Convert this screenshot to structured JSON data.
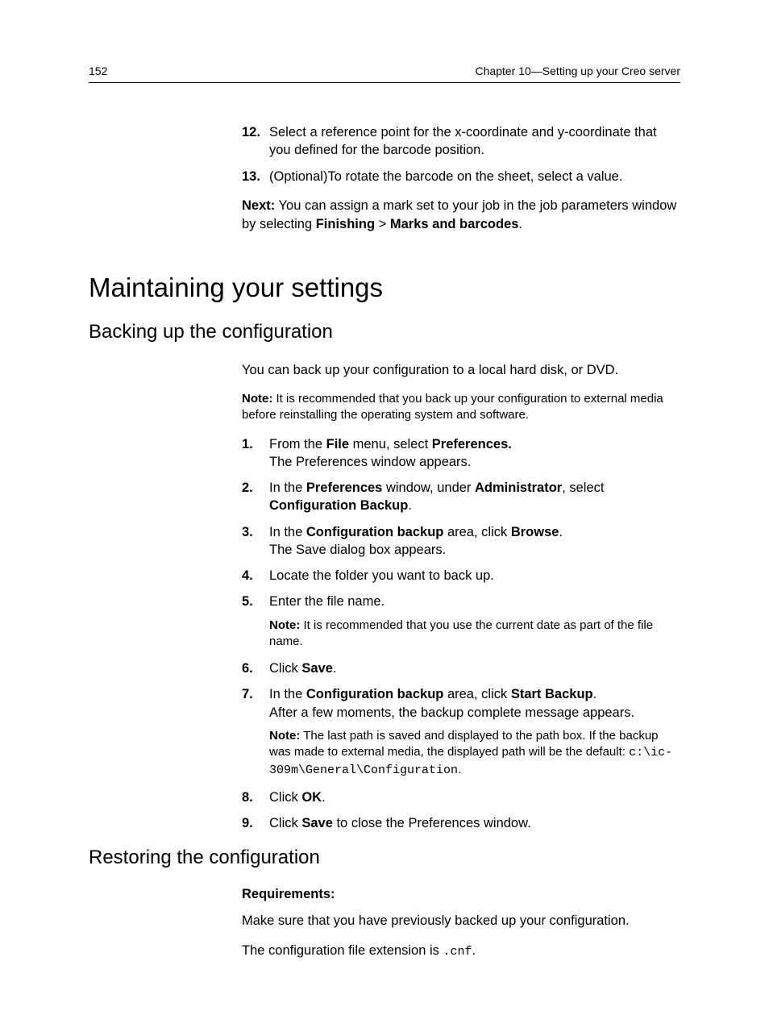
{
  "header": {
    "page_number": "152",
    "chapter": "Chapter 10—Setting up your Creo server"
  },
  "top_steps": {
    "s12": {
      "num": "12.",
      "text": "Select a reference point for the x-coordinate and y-coordinate that you defined for the barcode position."
    },
    "s13": {
      "num": "13.",
      "text": "(Optional)To rotate the barcode on the sheet, select a value."
    }
  },
  "next_block": {
    "label": "Next:",
    "pre": " You can assign a mark set to your job in the job parameters window by selecting ",
    "b1": "Finishing",
    "mid": " > ",
    "b2": "Marks and barcodes",
    "post": "."
  },
  "h1": "Maintaining your settings",
  "h2_backup": "Backing up the configuration",
  "backup_intro": "You can back up your configuration to a local hard disk, or DVD.",
  "backup_note_label": "Note:",
  "backup_note_text": " It is recommended that you back up your configuration to external media before reinstalling the operating system and software.",
  "backup_steps": {
    "s1": {
      "num": "1.",
      "pre": "From the ",
      "b1": "File",
      "mid": " menu, select ",
      "b2": "Preferences.",
      "line2": "The Preferences window appears."
    },
    "s2": {
      "num": "2.",
      "pre": "In the ",
      "b1": "Preferences",
      "mid": " window, under ",
      "b2": "Administrator",
      "post": ", select ",
      "b3": "Configuration Backup",
      "end": "."
    },
    "s3": {
      "num": "3.",
      "pre": "In the ",
      "b1": "Configuration backup",
      "mid": " area, click ",
      "b2": "Browse",
      "post": ".",
      "line2": "The Save dialog box appears."
    },
    "s4": {
      "num": "4.",
      "text": "Locate the folder you want to back up."
    },
    "s5": {
      "num": "5.",
      "text": "Enter the file name.",
      "note_label": "Note:",
      "note_text": " It is recommended that you use the current date as part of the file name."
    },
    "s6": {
      "num": "6.",
      "pre": "Click ",
      "b1": "Save",
      "post": "."
    },
    "s7": {
      "num": "7.",
      "pre": "In the ",
      "b1": "Configuration backup",
      "mid": " area, click ",
      "b2": "Start Backup",
      "post": ".",
      "line2": "After a few moments, the backup complete message appears.",
      "note_label": "Note:",
      "note_text_a": " The last path is saved and displayed to the path box. If the backup was made to external media, the displayed path will be the default: ",
      "note_code": "c:\\ic-309m\\General\\Configuration",
      "note_text_b": "."
    },
    "s8": {
      "num": "8.",
      "pre": "Click ",
      "b1": "OK",
      "post": "."
    },
    "s9": {
      "num": "9.",
      "pre": "Click ",
      "b1": "Save",
      "post": " to close the Preferences window."
    }
  },
  "h2_restore": "Restoring the configuration",
  "restore_req_label": "Requirements:",
  "restore_p1": "Make sure that you have previously backed up your configuration.",
  "restore_p2_a": "The configuration file extension is ",
  "restore_p2_code": ".cnf",
  "restore_p2_b": "."
}
